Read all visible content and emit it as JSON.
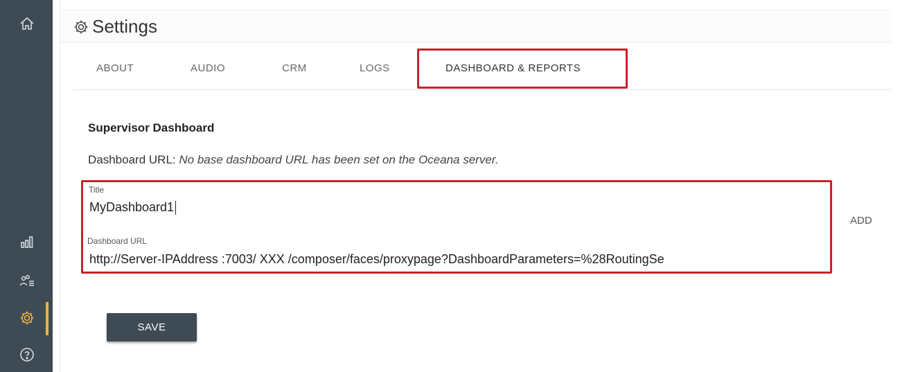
{
  "sidebar": {
    "icons": [
      "home-icon",
      "bar-chart-icon",
      "users-list-icon",
      "gear-icon",
      "help-icon"
    ]
  },
  "header": {
    "title": "Settings",
    "icon": "gear-icon"
  },
  "tabs": [
    {
      "label": "ABOUT"
    },
    {
      "label": "AUDIO"
    },
    {
      "label": "CRM"
    },
    {
      "label": "LOGS"
    },
    {
      "label": "DASHBOARD & REPORTS",
      "active": true
    }
  ],
  "section": {
    "title": "Supervisor Dashboard",
    "url_label": "Dashboard URL:",
    "url_note": "No base dashboard URL has been set on the Oceana server."
  },
  "form": {
    "title_label": "Title",
    "title_value": "MyDashboard1",
    "url_label": "Dashboard URL",
    "url_value": "http://Server-IPAddress :7003/ XXX /composer/faces/proxypage?DashboardParameters=%28RoutingSe"
  },
  "actions": {
    "add_label": "ADD",
    "save_label": "SAVE"
  },
  "colors": {
    "sidebar": "#3e4b54",
    "highlight": "#c8202a",
    "active_icon": "#f0b43c"
  }
}
